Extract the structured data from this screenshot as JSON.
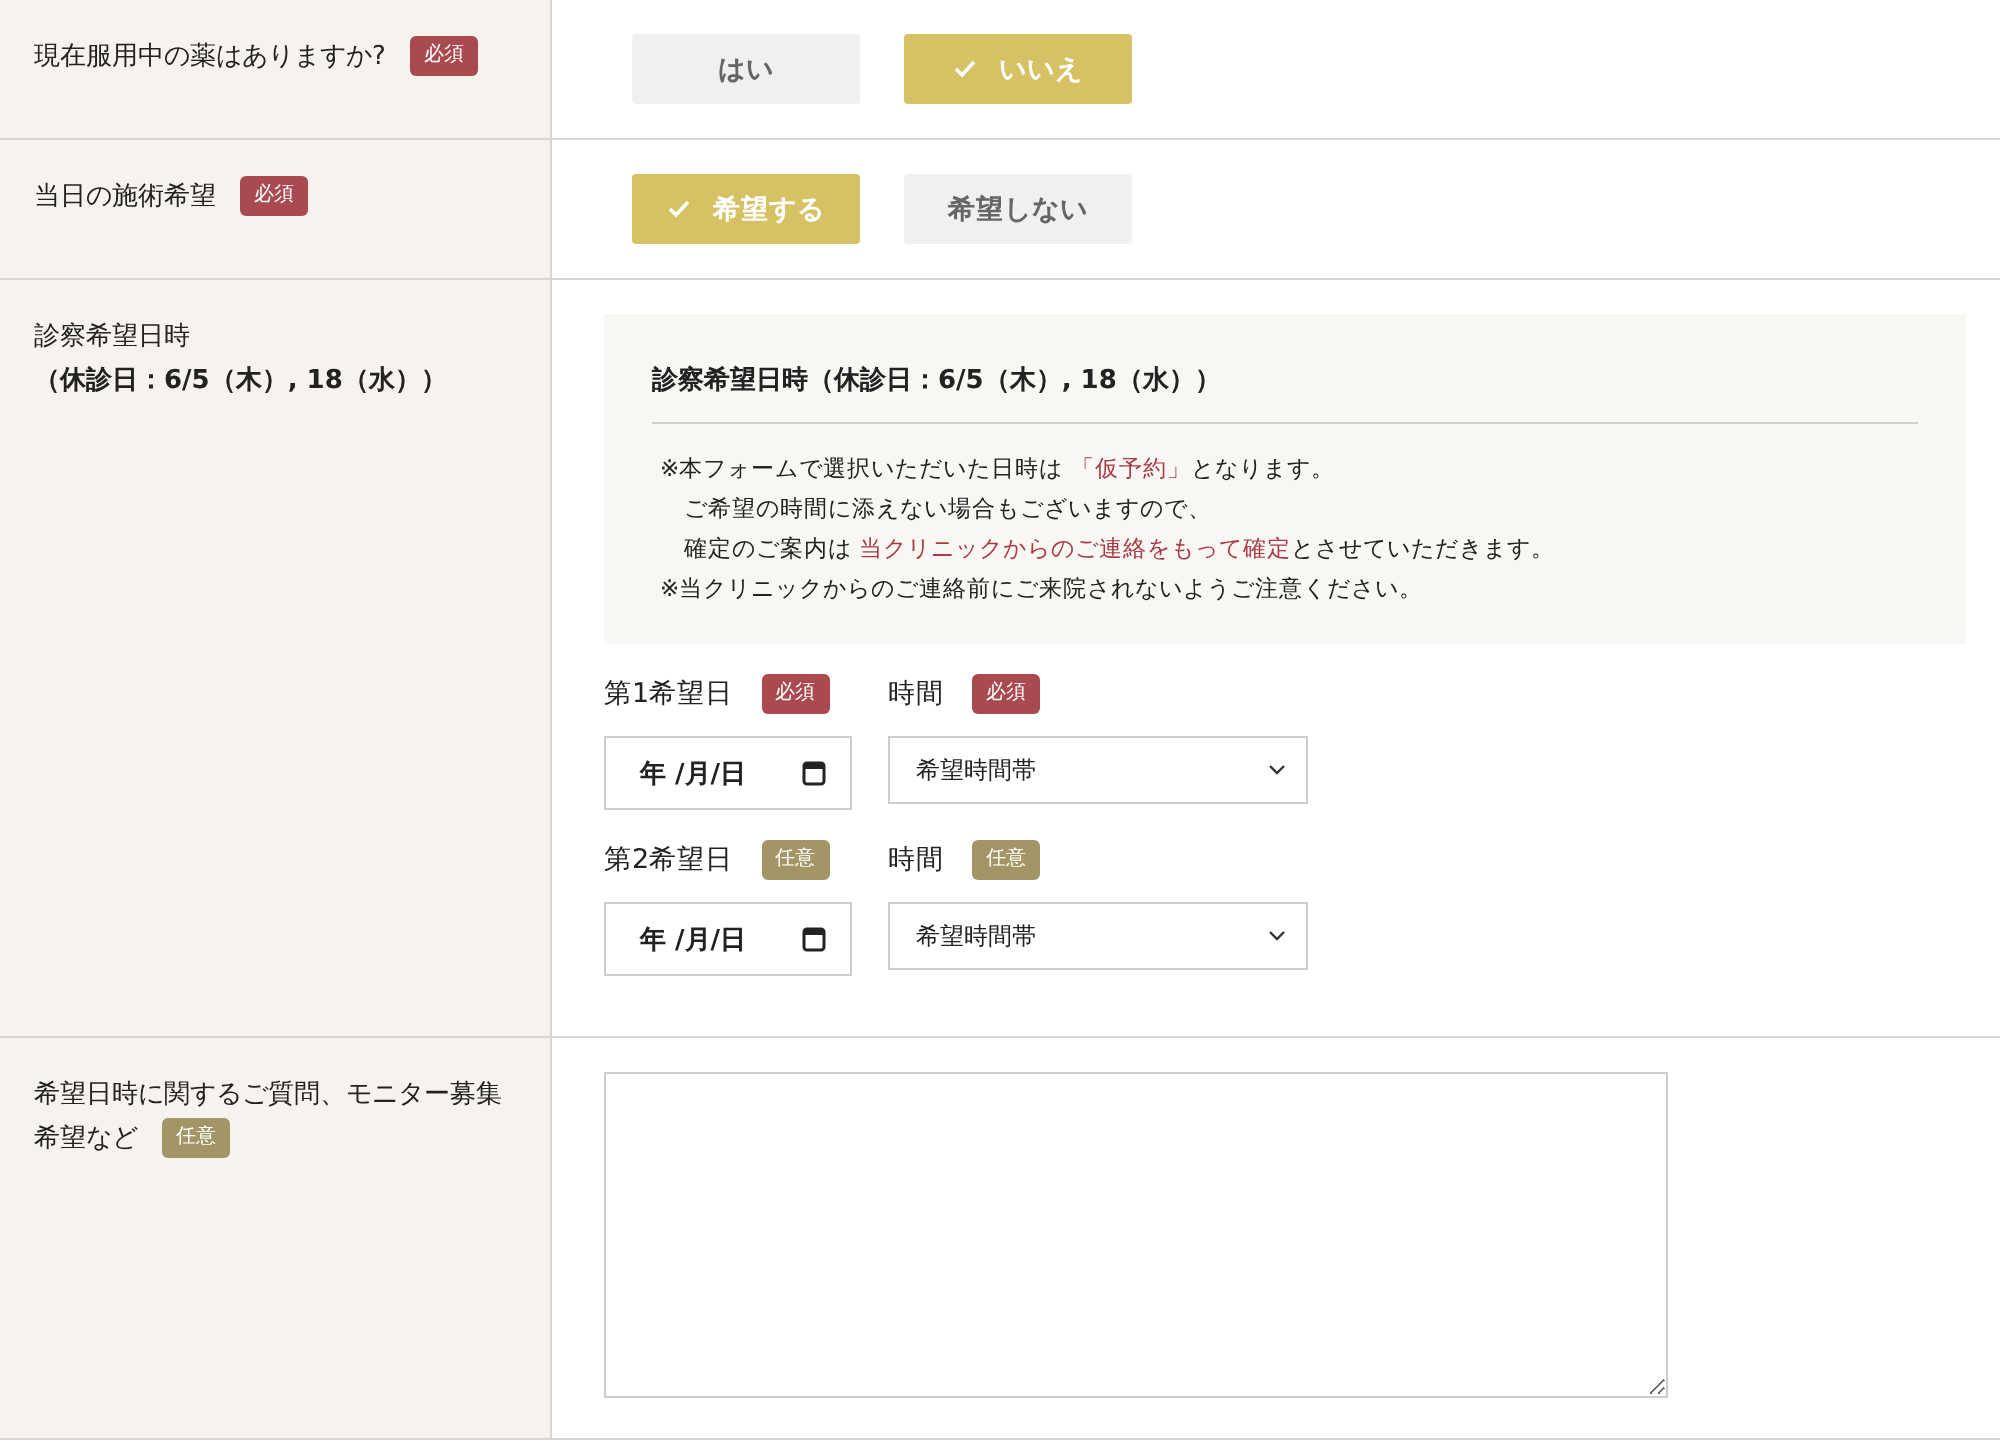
{
  "rows": [
    {
      "label_lines": [
        "現在服用中の薬はありますか?"
      ],
      "badge": {
        "label": "必須",
        "kind": "required"
      },
      "kind": "choice",
      "options": [
        {
          "label": "はい",
          "selected": false
        },
        {
          "label": "いいえ",
          "selected": true
        }
      ]
    },
    {
      "label_lines": [
        "当日の施術希望"
      ],
      "badge": {
        "label": "必須",
        "kind": "required"
      },
      "kind": "choice",
      "options": [
        {
          "label": "希望する",
          "selected": true
        },
        {
          "label": "希望しない",
          "selected": false
        }
      ]
    },
    {
      "label_lines": [
        "診察希望日時",
        "（休診日：6/5（木）, 18（水））"
      ],
      "kind": "schedule",
      "notice": {
        "title": "診察希望日時（休診日：6/5（木）, 18（水））",
        "lines": [
          [
            {
              "text": "※本フォームで選択いただいた日時は "
            },
            {
              "text": "「仮予約」",
              "highlight": true
            },
            {
              "text": "となります。"
            }
          ],
          [
            {
              "text": "　ご希望の時間に添えない場合もございますので、"
            }
          ],
          [
            {
              "text": "　確定のご案内は "
            },
            {
              "text": "当クリニックからのご連絡をもって確定",
              "highlight": true
            },
            {
              "text": "とさせていただきます。"
            }
          ],
          [
            {
              "text": "※当クリニックからのご連絡前にご来院されないようご注意ください。"
            }
          ]
        ]
      },
      "slots": [
        {
          "date_label": "第1希望日",
          "date_badge": {
            "label": "必須",
            "kind": "required"
          },
          "date_value": "年 /月/日",
          "time_label": "時間",
          "time_badge": {
            "label": "必須",
            "kind": "required"
          },
          "time_value": "希望時間帯"
        },
        {
          "date_label": "第2希望日",
          "date_badge": {
            "label": "任意",
            "kind": "optional"
          },
          "date_value": "年 /月/日",
          "time_label": "時間",
          "time_badge": {
            "label": "任意",
            "kind": "optional"
          },
          "time_value": "希望時間帯"
        }
      ]
    },
    {
      "label_lines": [
        "希望日時に関するご質問、モニター募集",
        "希望など"
      ],
      "badge": {
        "label": "任意",
        "kind": "optional"
      },
      "kind": "textarea"
    }
  ]
}
